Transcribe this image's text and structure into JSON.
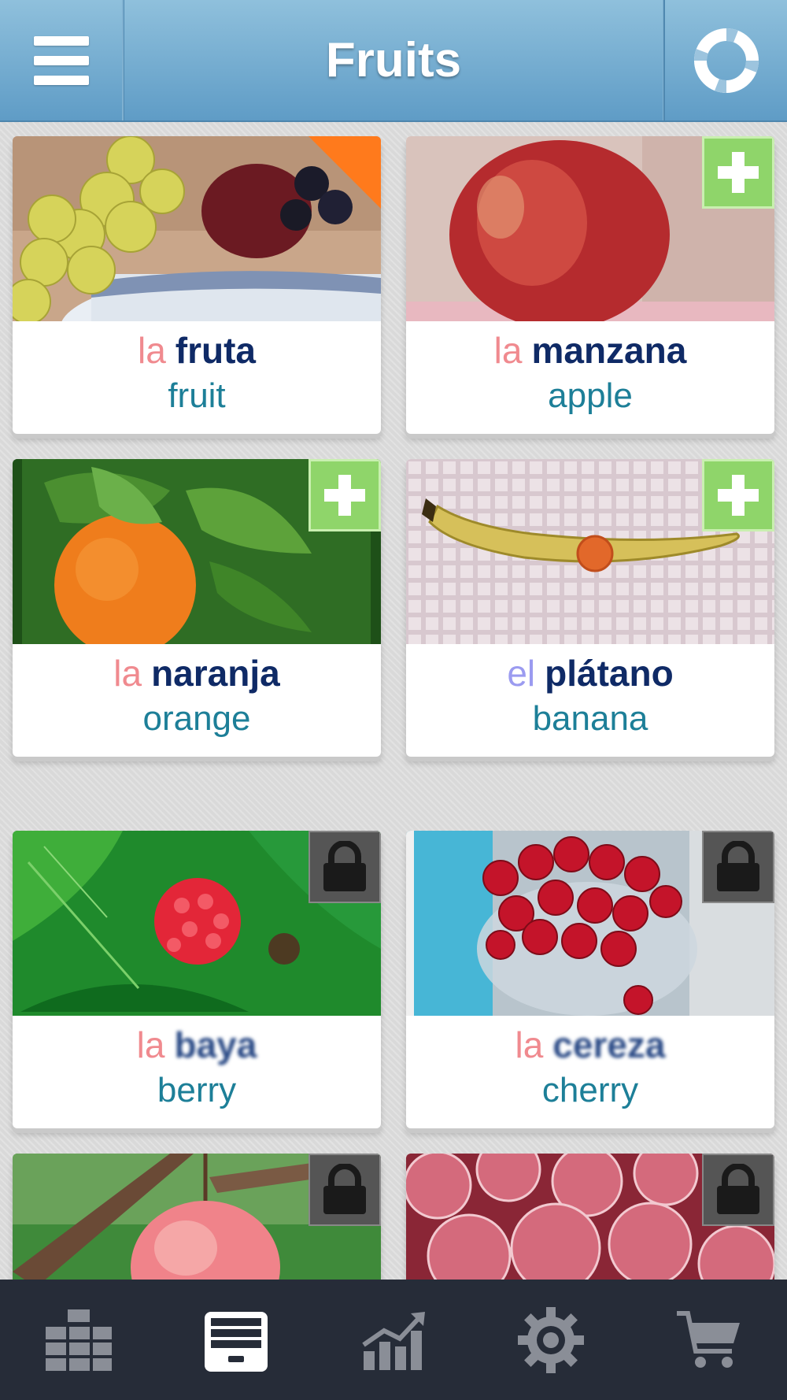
{
  "header": {
    "title": "Fruits",
    "menu_icon": "hamburger-menu-icon",
    "help_icon": "lifebuoy-icon"
  },
  "cards": [
    {
      "article": "la",
      "gender": "fem",
      "term": "fruta",
      "translation": "fruit",
      "badge": "new-corner",
      "blurred": false
    },
    {
      "article": "la",
      "gender": "fem",
      "term": "manzana",
      "translation": "apple",
      "badge": "plus",
      "blurred": false
    },
    {
      "article": "la",
      "gender": "fem",
      "term": "naranja",
      "translation": "orange",
      "badge": "plus",
      "blurred": false
    },
    {
      "article": "el",
      "gender": "masc",
      "term": "plátano",
      "translation": "banana",
      "badge": "plus",
      "blurred": false
    },
    {
      "article": "la",
      "gender": "fem",
      "term": "baya",
      "translation": "berry",
      "badge": "lock",
      "blurred": true
    },
    {
      "article": "la",
      "gender": "fem",
      "term": "cereza",
      "translation": "cherry",
      "badge": "lock",
      "blurred": true
    },
    {
      "article": "",
      "gender": "",
      "term": "",
      "translation": "",
      "badge": "lock",
      "blurred": true
    },
    {
      "article": "",
      "gender": "",
      "term": "",
      "translation": "",
      "badge": "lock",
      "blurred": true
    }
  ],
  "tabbar": {
    "tabs": [
      {
        "icon": "grid-categories-icon",
        "active": false
      },
      {
        "icon": "card-box-icon",
        "active": true
      },
      {
        "icon": "progress-chart-icon",
        "active": false
      },
      {
        "icon": "settings-gear-icon",
        "active": false
      },
      {
        "icon": "shopping-cart-icon",
        "active": false
      }
    ]
  },
  "colors": {
    "header_top": "#8fc0dc",
    "header_bottom": "#5f9cc6",
    "article_feminine": "#f08a8f",
    "article_masculine": "#9b9bf0",
    "term": "#0f2a66",
    "translation": "#1d7f98",
    "plus_badge": "#8fd56a",
    "new_corner": "#ff7a1c",
    "tabbar_bg": "#262c38"
  }
}
